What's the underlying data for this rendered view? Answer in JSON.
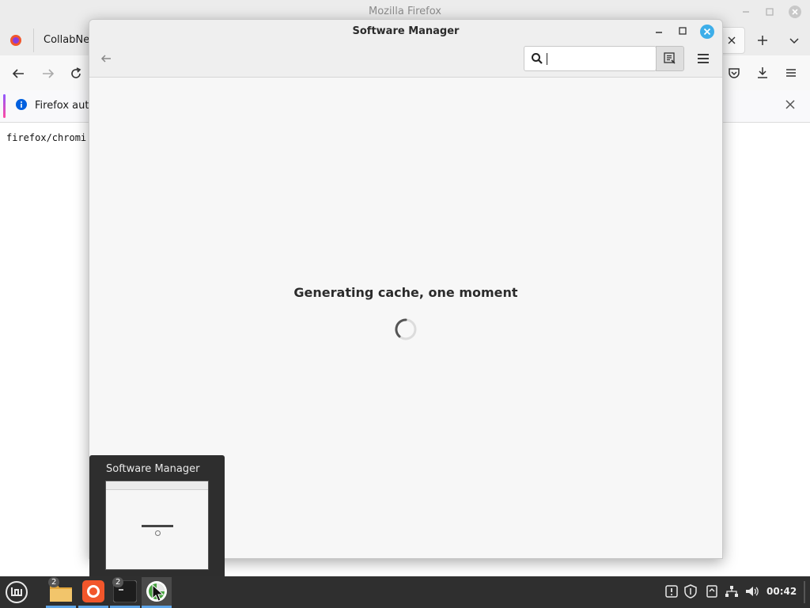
{
  "firefox": {
    "window_title": "Mozilla Firefox",
    "tab_label": "CollabNe",
    "notification_text": "Firefox auto",
    "page_text": "firefox/chromi"
  },
  "software_manager": {
    "title": "Software Manager",
    "search": {
      "value": "",
      "placeholder": ""
    },
    "status_message": "Generating cache, one moment"
  },
  "preview": {
    "title": "Software Manager"
  },
  "taskbar": {
    "files_badge": "2",
    "terminal_badge": "2",
    "clock": "00:42"
  },
  "colors": {
    "accent": "#3daee9",
    "panel": "#2f2f2f",
    "active_underline": "#5fa6e9",
    "firefox_orange": "#f2562b"
  },
  "icons": [
    "firefox-icon",
    "back-icon",
    "forward-icon",
    "reload-icon",
    "info-icon",
    "close-icon",
    "search-icon",
    "filter-icon",
    "menu-icon",
    "mint-menu-icon",
    "files-icon",
    "terminal-icon",
    "mintinstall-icon",
    "network-icon",
    "volume-icon",
    "shield-icon"
  ]
}
